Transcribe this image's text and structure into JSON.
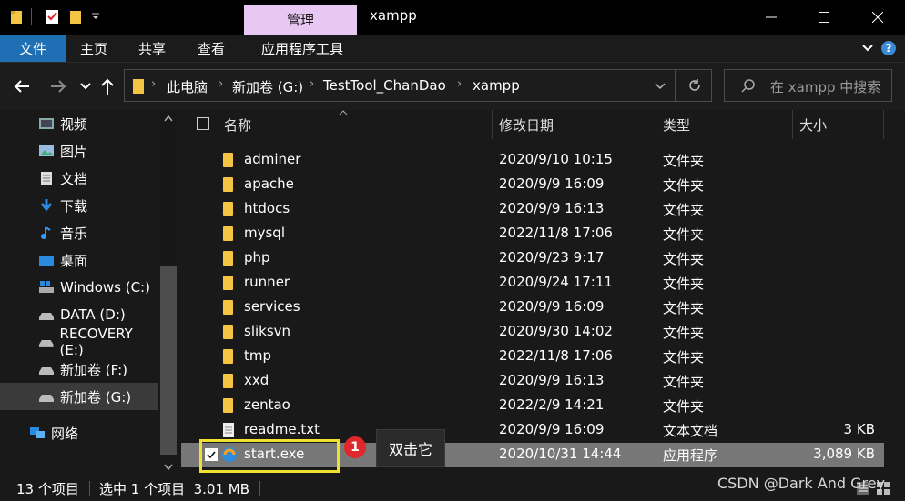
{
  "titlebar": {
    "ribbon_context_tab": "管理",
    "window_title": "xampp",
    "colors": {
      "accent": "#1f6fb5",
      "context_tab": "#e8c8f2"
    }
  },
  "ribbon": {
    "tabs": [
      "文件",
      "主页",
      "共享",
      "查看",
      "应用程序工具"
    ]
  },
  "address": {
    "crumbs": [
      "此电脑",
      "新加卷 (G:)",
      "TestTool_ChanDao",
      "xampp"
    ],
    "search_placeholder": "在 xampp 中搜索"
  },
  "sidebar": {
    "items": [
      {
        "label": "视频",
        "icon": "video-icon"
      },
      {
        "label": "图片",
        "icon": "pictures-icon"
      },
      {
        "label": "文档",
        "icon": "documents-icon"
      },
      {
        "label": "下载",
        "icon": "download-icon"
      },
      {
        "label": "音乐",
        "icon": "music-icon"
      },
      {
        "label": "桌面",
        "icon": "desktop-icon"
      },
      {
        "label": "Windows (C:)",
        "icon": "windows-drive-icon"
      },
      {
        "label": "DATA (D:)",
        "icon": "drive-icon"
      },
      {
        "label": "RECOVERY (E:)",
        "icon": "drive-icon"
      },
      {
        "label": "新加卷 (F:)",
        "icon": "drive-icon"
      },
      {
        "label": "新加卷 (G:)",
        "icon": "drive-icon"
      },
      {
        "label": "网络",
        "icon": "network-icon"
      }
    ]
  },
  "columns": {
    "name": "名称",
    "date": "修改日期",
    "type": "类型",
    "size": "大小"
  },
  "files": [
    {
      "name": "adminer",
      "date": "2020/9/10 10:15",
      "type": "文件夹",
      "size": ""
    },
    {
      "name": "apache",
      "date": "2020/9/9 16:09",
      "type": "文件夹",
      "size": ""
    },
    {
      "name": "htdocs",
      "date": "2020/9/9 16:13",
      "type": "文件夹",
      "size": ""
    },
    {
      "name": "mysql",
      "date": "2022/11/8 17:06",
      "type": "文件夹",
      "size": ""
    },
    {
      "name": "php",
      "date": "2020/9/23 9:17",
      "type": "文件夹",
      "size": ""
    },
    {
      "name": "runner",
      "date": "2020/9/24 17:11",
      "type": "文件夹",
      "size": ""
    },
    {
      "name": "services",
      "date": "2020/9/9 16:09",
      "type": "文件夹",
      "size": ""
    },
    {
      "name": "sliksvn",
      "date": "2020/9/30 14:02",
      "type": "文件夹",
      "size": ""
    },
    {
      "name": "tmp",
      "date": "2022/11/8 17:06",
      "type": "文件夹",
      "size": ""
    },
    {
      "name": "xxd",
      "date": "2020/9/9 16:13",
      "type": "文件夹",
      "size": ""
    },
    {
      "name": "zentao",
      "date": "2022/2/9 14:21",
      "type": "文件夹",
      "size": ""
    },
    {
      "name": "readme.txt",
      "date": "2020/9/9 16:09",
      "type": "文本文档",
      "size": "3 KB"
    },
    {
      "name": "start.exe",
      "date": "2020/10/31 14:44",
      "type": "应用程序",
      "size": "3,089 KB"
    }
  ],
  "annotation": {
    "badge": "1",
    "text": "双击它",
    "highlight_color": "#f0e030",
    "badge_color": "#e0272b"
  },
  "status": {
    "count": "13 个项目",
    "selected": "选中 1 个项目  3.01 MB"
  },
  "watermark": "CSDN @Dark And Grey"
}
